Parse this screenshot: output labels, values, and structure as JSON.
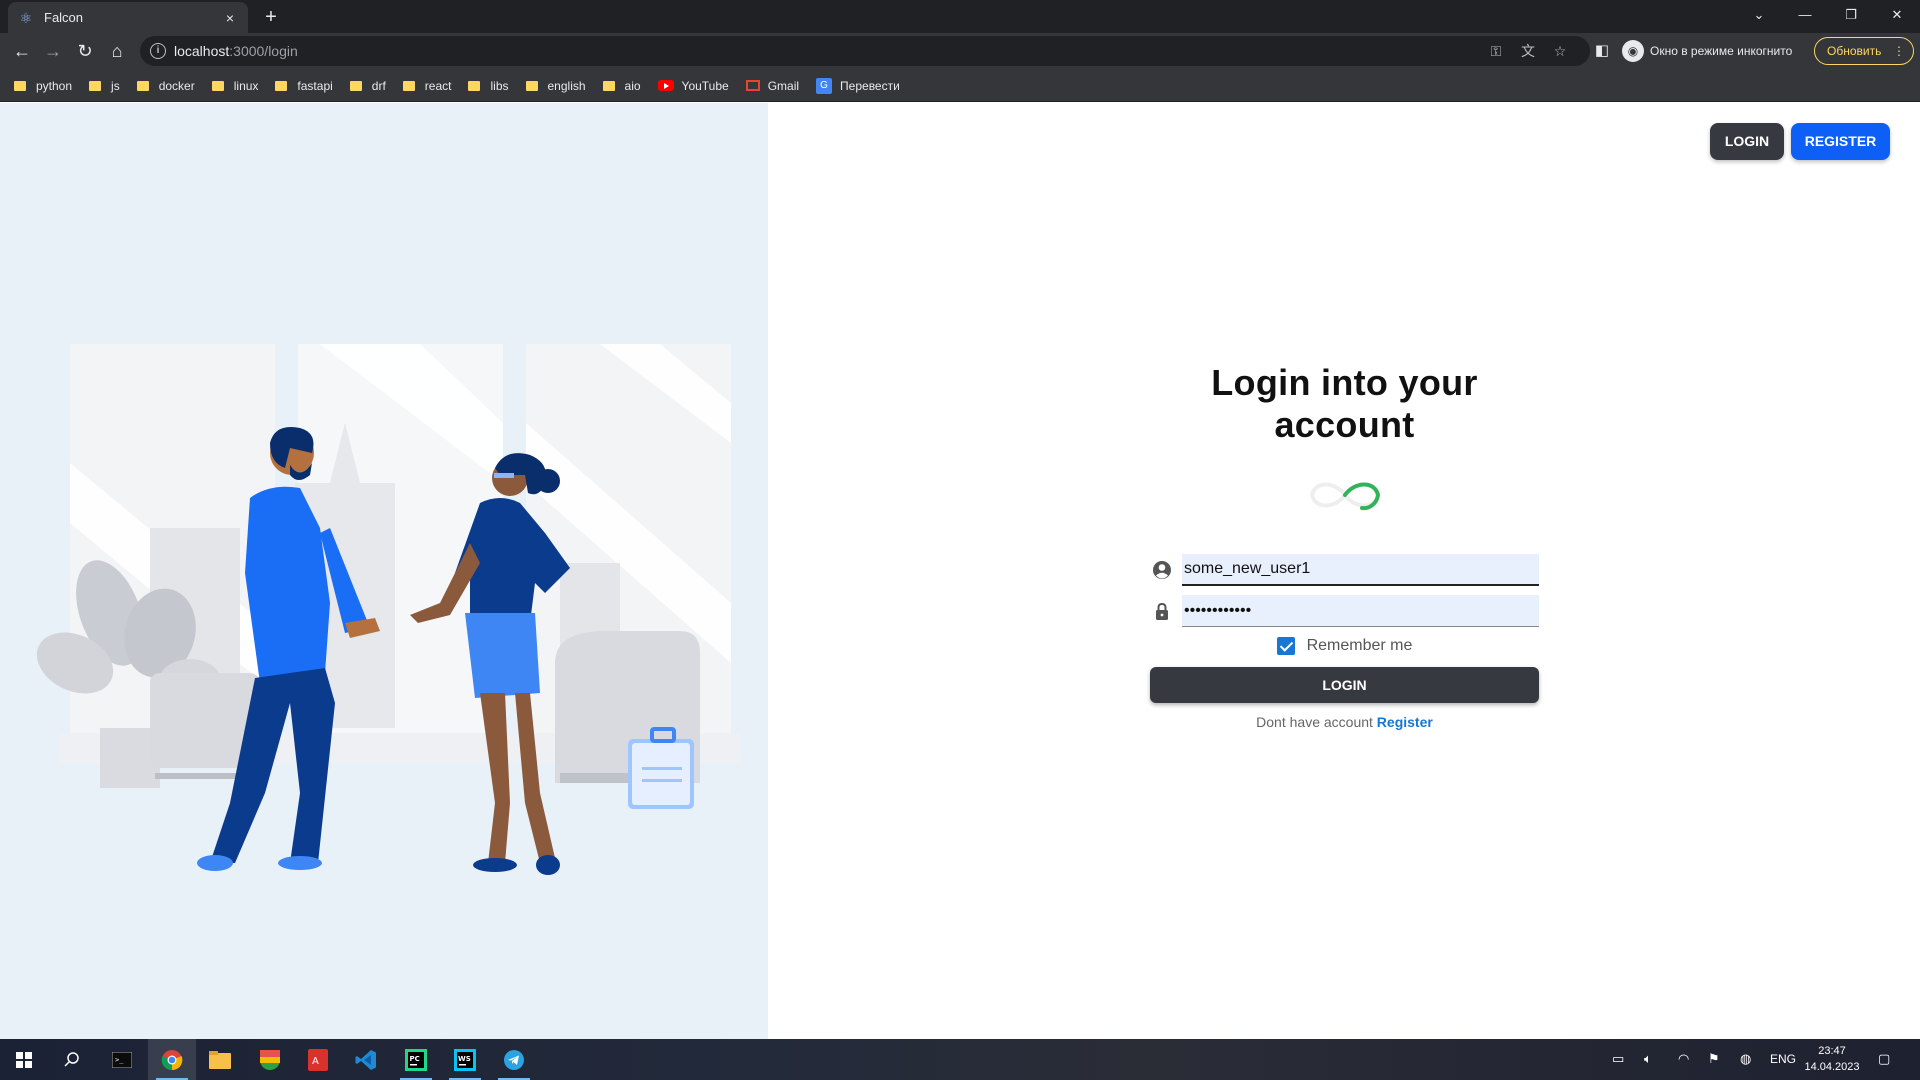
{
  "browser": {
    "tab": {
      "title": "Falcon",
      "close": "×"
    },
    "new_tab": "+",
    "url_host": "localhost",
    "url_path": ":3000/login",
    "incognito_label": "Окно в режиме инкогнито",
    "update_label": "Обновить",
    "bookmarks": [
      {
        "label": "python",
        "icon": "folder-icon"
      },
      {
        "label": "js",
        "icon": "folder-icon"
      },
      {
        "label": "docker",
        "icon": "folder-icon"
      },
      {
        "label": "linux",
        "icon": "folder-icon"
      },
      {
        "label": "fastapi",
        "icon": "folder-icon"
      },
      {
        "label": "drf",
        "icon": "folder-icon"
      },
      {
        "label": "react",
        "icon": "folder-icon"
      },
      {
        "label": "libs",
        "icon": "folder-icon"
      },
      {
        "label": "english",
        "icon": "folder-icon"
      },
      {
        "label": "aio",
        "icon": "folder-icon"
      },
      {
        "label": "YouTube",
        "icon": "youtube-icon"
      },
      {
        "label": "Gmail",
        "icon": "gmail-icon"
      },
      {
        "label": "Перевести",
        "icon": "translate-icon"
      }
    ]
  },
  "header": {
    "login_label": "LOGIN",
    "register_label": "REGISTER"
  },
  "form": {
    "title": "Login into your account",
    "username_value": "some_new_user1",
    "password_value": "••••••••••••",
    "remember_label": "Remember me",
    "remember_checked": true,
    "submit_label": "LOGIN",
    "signup_text": "Dont have account",
    "signup_link": "Register"
  },
  "taskbar": {
    "language": "ENG",
    "time": "23:47",
    "date": "14.04.2023"
  },
  "colors": {
    "accent": "#0d5ff5",
    "dark_button": "#363a40",
    "left_panel_bg": "#e8f0f8",
    "link": "#1976d2"
  }
}
